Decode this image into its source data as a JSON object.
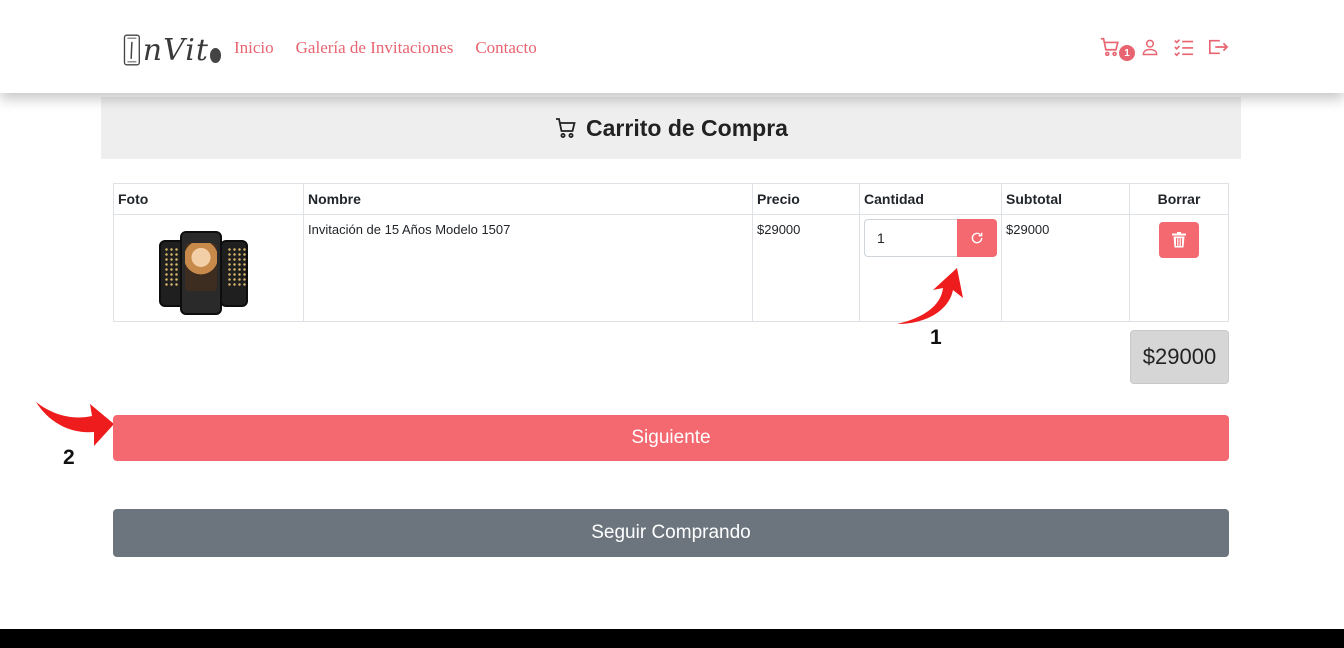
{
  "header": {
    "logo_text": "nVit",
    "nav": [
      "Inicio",
      "Galería de Invitaciones",
      "Contacto"
    ],
    "cart_count": "1",
    "icons": [
      "cart-icon",
      "user-icon",
      "checklist-icon",
      "logout-icon"
    ],
    "accent_color": "#e76470"
  },
  "page": {
    "title": "Carrito de Compra"
  },
  "table": {
    "headers": {
      "foto": "Foto",
      "nombre": "Nombre",
      "precio": "Precio",
      "cantidad": "Cantidad",
      "subtotal": "Subtotal",
      "borrar": "Borrar"
    },
    "rows": [
      {
        "nombre": "Invitación de 15 Años Modelo 1507",
        "precio": "$29000",
        "cantidad": "1",
        "subtotal": "$29000"
      }
    ]
  },
  "total": "$29000",
  "buttons": {
    "next": "Siguiente",
    "continue": "Seguir Comprando"
  },
  "annotations": {
    "one": "1",
    "two": "2"
  }
}
